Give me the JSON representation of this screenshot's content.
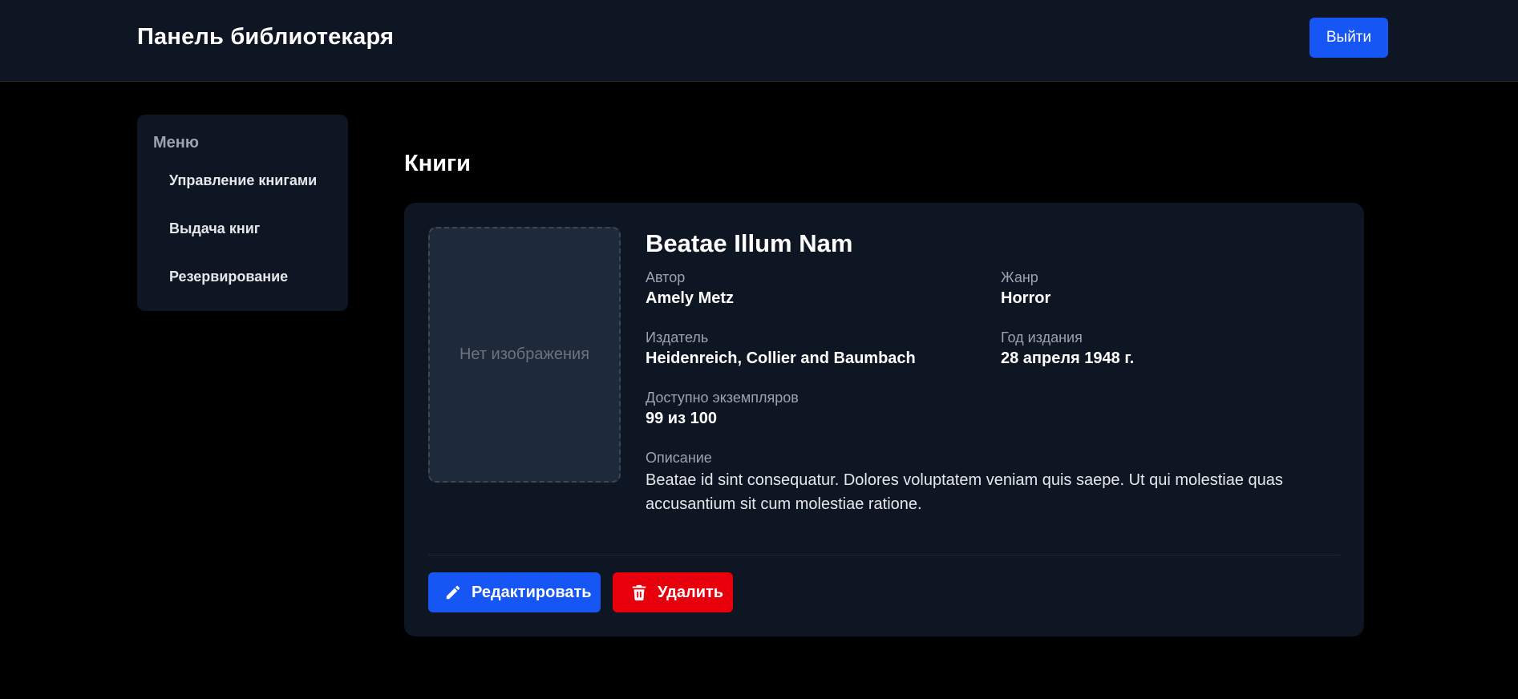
{
  "header": {
    "title": "Панель библиотекаря",
    "logout_label": "Выйти"
  },
  "sidebar": {
    "title": "Меню",
    "items": [
      {
        "label": "Управление книгами"
      },
      {
        "label": "Выдача книг"
      },
      {
        "label": "Резервирование"
      }
    ]
  },
  "main": {
    "heading": "Книги",
    "book": {
      "cover_placeholder": "Нет изображения",
      "title": "Beatae Illum Nam",
      "author_label": "Автор",
      "author": "Amely Metz",
      "genre_label": "Жанр",
      "genre": "Horror",
      "publisher_label": "Издатель",
      "publisher": "Heidenreich, Collier and Baumbach",
      "year_label": "Год издания",
      "year": "28 апреля 1948 г.",
      "available_label": "Доступно экземпляров",
      "available": "99 из 100",
      "description_label": "Описание",
      "description": "Beatae id sint consequatur. Dolores voluptatem veniam quis saepe. Ut qui molestiae quas accusantium sit cum molestiae ratione."
    },
    "actions": {
      "edit_label": "Редактировать",
      "delete_label": "Удалить",
      "edit_icon": "pencil-icon",
      "delete_icon": "trash-icon"
    }
  },
  "colors": {
    "primary": "#1556f5",
    "danger": "#e7000b",
    "surface": "#0f1623",
    "background": "#000000"
  }
}
